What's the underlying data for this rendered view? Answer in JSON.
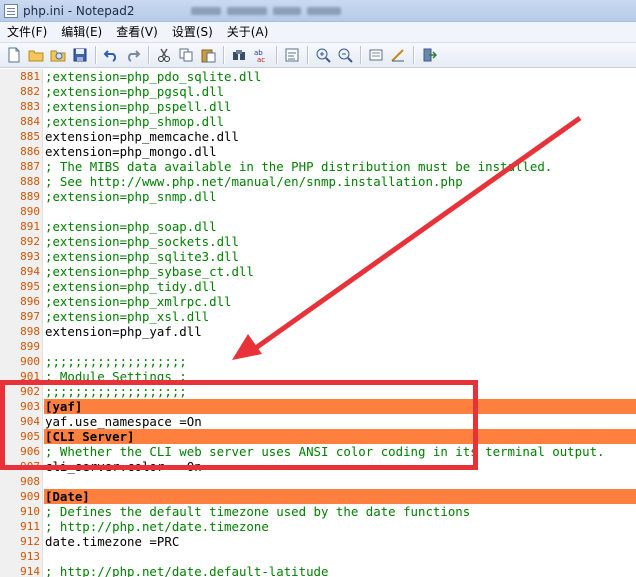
{
  "window": {
    "title": "php.ini - Notepad2"
  },
  "menu": {
    "items": [
      "文件(F)",
      "编辑(E)",
      "查看(V)",
      "设置(S)",
      "关于(A)"
    ]
  },
  "toolbar": {
    "icons": [
      "new-file-icon",
      "open-folder-icon",
      "browse-icon",
      "save-icon",
      "undo-icon",
      "redo-icon",
      "cut-icon",
      "copy-icon",
      "paste-icon",
      "find-icon",
      "replace-icon",
      "wrap-icon",
      "zoom-in-icon",
      "zoom-out-icon",
      "schema-icon",
      "customize-icon",
      "exit-icon"
    ]
  },
  "colors": {
    "highlight": "#ff7f3f",
    "line_numbers": "#d35400",
    "comment": "#008000",
    "annotation": "#e8323a"
  },
  "editor": {
    "lines": [
      {
        "num": "881",
        "text": ";extension=php_pdo_sqlite.dll",
        "kind": "comment"
      },
      {
        "num": "882",
        "text": ";extension=php_pgsql.dll",
        "kind": "comment"
      },
      {
        "num": "883",
        "text": ";extension=php_pspell.dll",
        "kind": "comment"
      },
      {
        "num": "884",
        "text": ";extension=php_shmop.dll",
        "kind": "comment"
      },
      {
        "num": "885",
        "text": "extension=php_memcache.dll",
        "kind": "code"
      },
      {
        "num": "886",
        "text": "extension=php_mongo.dll",
        "kind": "code"
      },
      {
        "num": "887",
        "text": "; The MIBS data available in the PHP distribution must be installed.",
        "kind": "comment"
      },
      {
        "num": "888",
        "text": "; See http://www.php.net/manual/en/snmp.installation.php",
        "kind": "comment"
      },
      {
        "num": "889",
        "text": ";extension=php_snmp.dll",
        "kind": "comment"
      },
      {
        "num": "890",
        "text": "",
        "kind": "code"
      },
      {
        "num": "891",
        "text": ";extension=php_soap.dll",
        "kind": "comment"
      },
      {
        "num": "892",
        "text": ";extension=php_sockets.dll",
        "kind": "comment"
      },
      {
        "num": "893",
        "text": ";extension=php_sqlite3.dll",
        "kind": "comment"
      },
      {
        "num": "894",
        "text": ";extension=php_sybase_ct.dll",
        "kind": "comment"
      },
      {
        "num": "895",
        "text": ";extension=php_tidy.dll",
        "kind": "comment"
      },
      {
        "num": "896",
        "text": ";extension=php_xmlrpc.dll",
        "kind": "comment"
      },
      {
        "num": "897",
        "text": ";extension=php_xsl.dll",
        "kind": "comment"
      },
      {
        "num": "898",
        "text": "extension=php_yaf.dll",
        "kind": "code"
      },
      {
        "num": "899",
        "text": "",
        "kind": "code"
      },
      {
        "num": "900",
        "text": ";;;;;;;;;;;;;;;;;;;",
        "kind": "comment"
      },
      {
        "num": "901",
        "text": "; Module Settings ;",
        "kind": "comment"
      },
      {
        "num": "902",
        "text": ";;;;;;;;;;;;;;;;;;;",
        "kind": "comment"
      },
      {
        "num": "903",
        "text": "[yaf]",
        "kind": "section"
      },
      {
        "num": "904",
        "text": "yaf.use_namespace =On",
        "kind": "code"
      },
      {
        "num": "905",
        "text": "[CLI Server]",
        "kind": "section"
      },
      {
        "num": "906",
        "text": "; Whether the CLI web server uses ANSI color coding in its terminal output.",
        "kind": "comment"
      },
      {
        "num": "907",
        "text": "cli_server.color = On",
        "kind": "code"
      },
      {
        "num": "908",
        "text": "",
        "kind": "code"
      },
      {
        "num": "909",
        "text": "[Date]",
        "kind": "section"
      },
      {
        "num": "910",
        "text": "; Defines the default timezone used by the date functions",
        "kind": "comment"
      },
      {
        "num": "911",
        "text": "; http://php.net/date.timezone",
        "kind": "comment"
      },
      {
        "num": "912",
        "text": "date.timezone =PRC",
        "kind": "code"
      },
      {
        "num": "913",
        "text": "",
        "kind": "code"
      },
      {
        "num": "914",
        "text": "; http://php.net/date.default-latitude",
        "kind": "comment"
      }
    ]
  }
}
